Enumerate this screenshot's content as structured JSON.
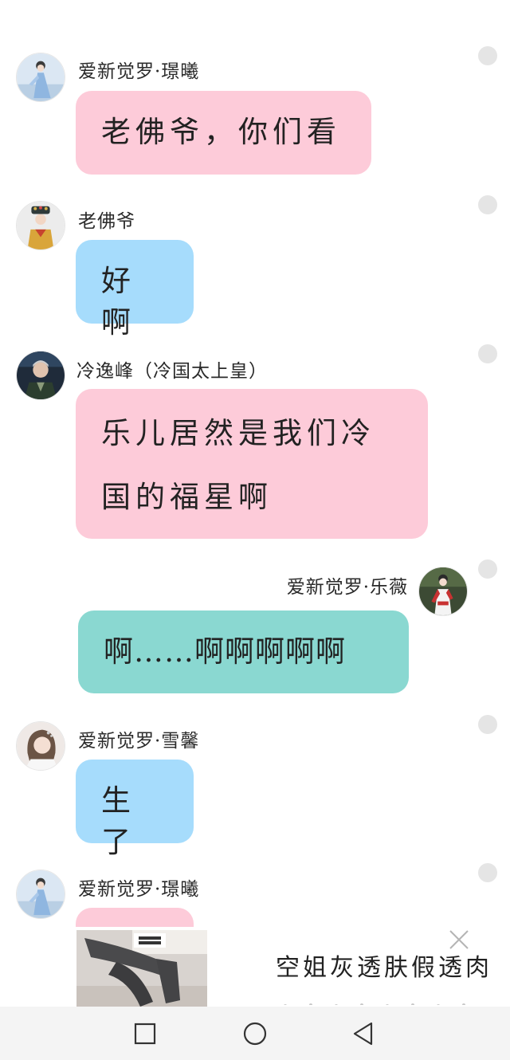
{
  "messages": [
    {
      "sender": "爱新觉罗·璟曦",
      "text": "老佛爷，你们看",
      "avatar_icon": "avatar-woman-blue-robe-icon",
      "bubble_color": "#fdcbd9"
    },
    {
      "sender": "老佛爷",
      "text": "好啊",
      "avatar_icon": "avatar-empress-headdress-icon",
      "bubble_color": "#a6dcfc"
    },
    {
      "sender": "冷逸峰（冷国太上皇）",
      "text_lines": [
        "乐儿居然是我们冷",
        "国的福星啊"
      ],
      "avatar_icon": "avatar-man-dark-icon",
      "bubble_color": "#fdcbd9"
    },
    {
      "sender": "爱新觉罗·乐薇",
      "text": "啊……啊啊啊啊啊",
      "avatar_icon": "avatar-girl-red-white-icon",
      "bubble_color": "#8ad8d1"
    },
    {
      "sender": "爱新觉罗·雪馨",
      "text": "生了",
      "avatar_icon": "avatar-woman-light-icon",
      "bubble_color": "#a6dcfc"
    },
    {
      "sender": "爱新觉罗·璟曦",
      "text": "",
      "avatar_icon": "avatar-woman-blue-robe-icon",
      "bubble_color": "#fdcbd9"
    }
  ],
  "ad": {
    "title": "空姐灰透肤假透肉",
    "close_icon": "close-icon",
    "thumb_icon": "stockings-photo-icon"
  },
  "navbar": {
    "recent_icon": "square-recent-apps-icon",
    "home_icon": "circle-home-icon",
    "back_icon": "triangle-back-icon"
  },
  "colors": {
    "pink_bubble": "#fdcbd9",
    "blue_bubble": "#a6dcfc",
    "teal_bubble": "#8ad8d1",
    "status_dot": "#e5e5e5",
    "navbar_bg": "#f4f4f4"
  }
}
